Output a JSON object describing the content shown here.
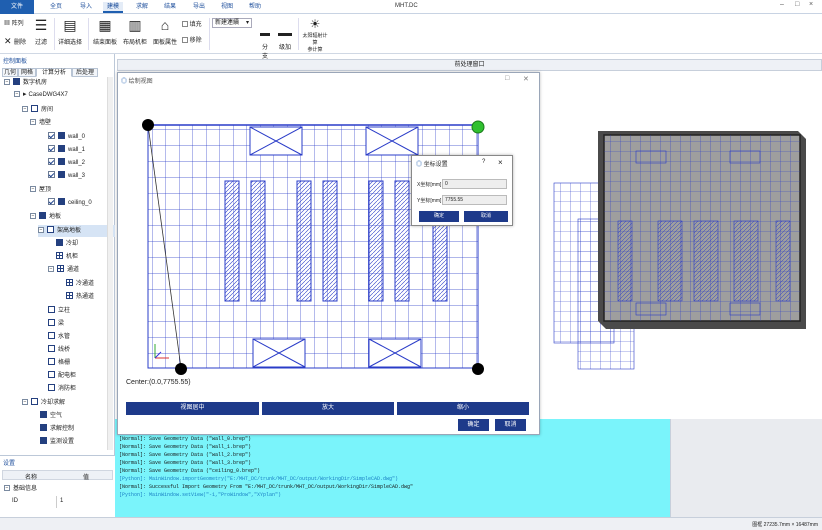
{
  "app": {
    "title": "MHT.DC",
    "win_min": "–",
    "win_max": "□",
    "win_close": "×"
  },
  "tabs": {
    "file": "文件",
    "items": [
      "全页",
      "导入",
      "建模",
      "求解",
      "结果",
      "导出",
      "视图",
      "帮助"
    ]
  },
  "ribbon": {
    "array": "阵列",
    "delete": "删除",
    "filter": "过滤",
    "detail_choice": "详细选择",
    "equip_panel": "结束面板",
    "layout_machine": "布局机柜",
    "panel_attr": "面板属性",
    "fill": "填充",
    "move": "移除",
    "combo": "新建連續",
    "div": "分支",
    "add_level": "级加",
    "solar": "太阳辐射计算",
    "solar2": "参计算"
  },
  "left": {
    "control_panel": "控制面板",
    "subtabs": [
      "几何",
      "网格",
      "计算分析",
      "后处理"
    ],
    "tree": {
      "root": "数字机房",
      "case": "CaseDWG4X7",
      "room": "房间",
      "walls": "墙壁",
      "wall0": "wall_0",
      "wall1": "wall_1",
      "wall2": "wall_2",
      "wall3": "wall_3",
      "ceiling": "屋顶",
      "ceiling0": "ceiling_0",
      "floor": "地板",
      "raised": "架高地板",
      "cooler": "冷却",
      "cabinet": "机柜",
      "duct": "通道",
      "cold": "冷通道",
      "hot": "热通道",
      "col": "立柱",
      "beam": "梁",
      "pipe": "水管",
      "bridge": "线桥",
      "grille": "格栅",
      "pdu": "配电柜",
      "fire": "消防柜",
      "solve": "冷却求解",
      "air": "空气",
      "ctrl": "求解控制",
      "monitor": "监测设置",
      "more": "..."
    },
    "props": {
      "title": "设置",
      "col_name": "名称",
      "col_value": "值",
      "basic": "基础信息",
      "id_label": "ID",
      "id_value": "1"
    }
  },
  "main": {
    "header": "前处理窗口"
  },
  "dialog": {
    "title": "绘制视图",
    "center_label": "Center:(0.0,7755.55)",
    "btn_center": "视图居中",
    "btn_zoom_in": "放大",
    "btn_zoom_out": "缩小",
    "ok": "确定",
    "cancel": "取消"
  },
  "coord_dialog": {
    "title": "坐标设置",
    "help": "?",
    "close": "×",
    "x_label": "X坐标[mm]",
    "x_value": "0",
    "y_label": "Y坐标[mm]",
    "y_value": "7755.55",
    "ok": "确定",
    "cancel": "取消"
  },
  "console": {
    "lines": [
      "[Normal]: Save Geometry Data (\"wall_0.brep\")",
      "[Normal]: Save Geometry Data (\"wall_1.brep\")",
      "[Normal]: Save Geometry Data (\"wall_2.brep\")",
      "[Normal]: Save Geometry Data (\"wall_3.brep\")",
      "[Normal]: Save Geometry Data (\"ceiling_0.brep\")"
    ],
    "py1": "[Python]: MainWindow.importGeometry(\"E:/MHT_DC/trunk/MHT_DC/output/WorkingDir/SimpleCAD.dwg\")",
    "last_normal": "[Normal]: Successful Import Geometry From \"E:/MHT_DC/trunk/MHT_DC/output/WorkingDir/SimpleCAD.dwg\"",
    "py2": "[Python]: MainWindow.setView(\"-1,\"ProWindow\",\"XYplan\")"
  },
  "status": {
    "text": "图框 27235.7mm × 16487mm"
  }
}
